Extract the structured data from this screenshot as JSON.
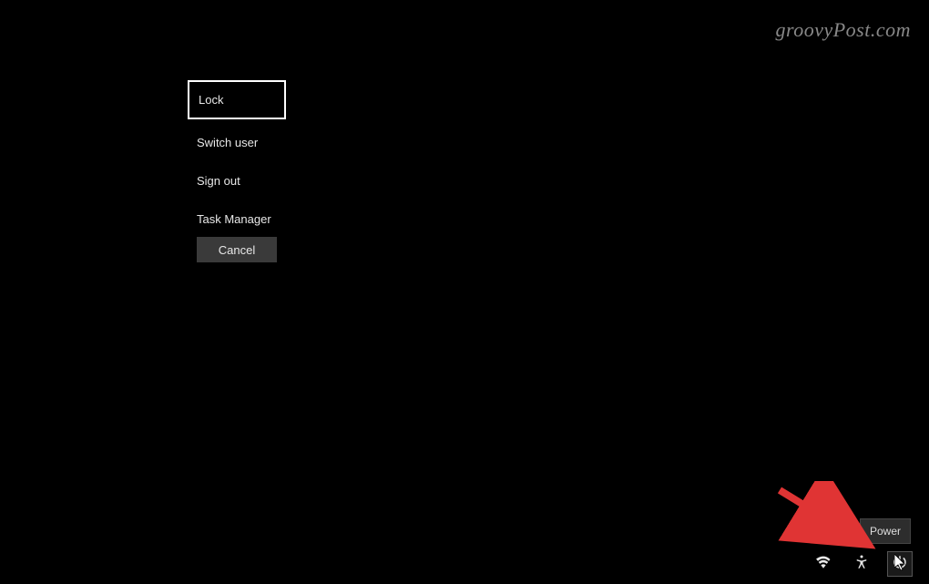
{
  "watermark": "groovyPost.com",
  "menu": {
    "items": [
      {
        "label": "Lock",
        "highlighted": true
      },
      {
        "label": "Switch user",
        "highlighted": false
      },
      {
        "label": "Sign out",
        "highlighted": false
      },
      {
        "label": "Task Manager",
        "highlighted": false
      }
    ],
    "cancel_label": "Cancel"
  },
  "tooltip": {
    "label": "Power"
  },
  "bottom_icons": {
    "wifi": "wifi-icon",
    "accessibility": "accessibility-icon",
    "power": "power-icon"
  },
  "annotation": {
    "arrow_color": "#e03434"
  }
}
